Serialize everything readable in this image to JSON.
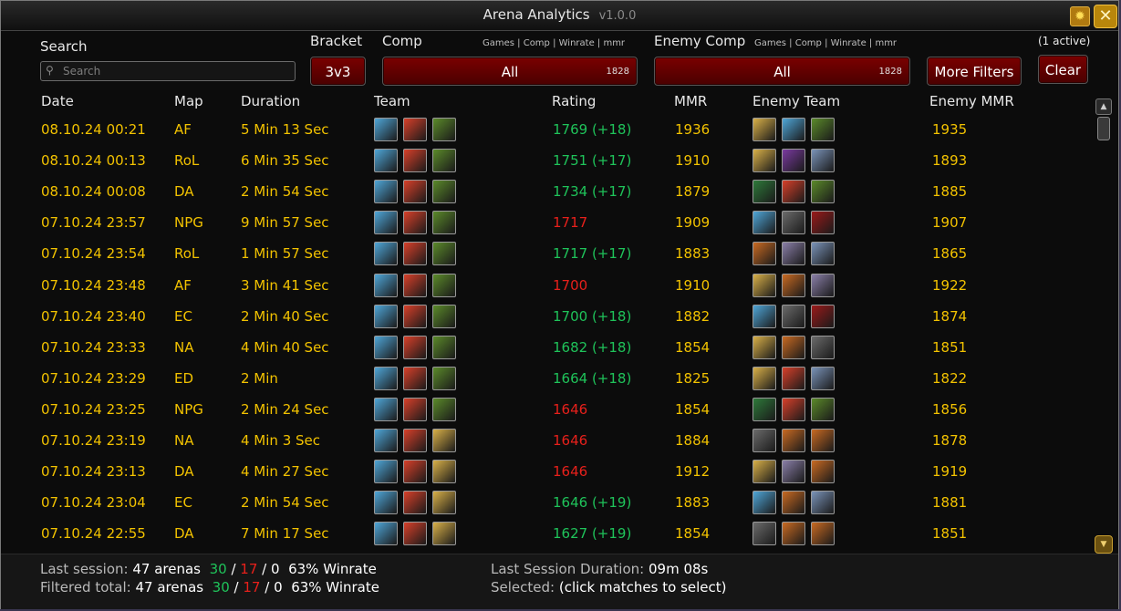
{
  "window": {
    "title": "Arena Analytics",
    "version": "v1.0.0"
  },
  "filters": {
    "search_label": "Search",
    "search_placeholder": "Search",
    "bracket_label": "Bracket",
    "bracket_value": "3v3",
    "comp_label": "Comp",
    "comp_subheader": "Games | Comp | Winrate | mmr",
    "comp_value": "All",
    "comp_count": "1828",
    "enemy_comp_label": "Enemy Comp",
    "enemy_comp_subheader": "Games | Comp | Winrate | mmr",
    "enemy_comp_value": "All",
    "enemy_comp_count": "1828",
    "more_filters_label": "More Filters",
    "active_label": "(1 active)",
    "clear_label": "Clear"
  },
  "columns": {
    "date": "Date",
    "map": "Map",
    "duration": "Duration",
    "team": "Team",
    "rating": "Rating",
    "mmr": "MMR",
    "enemy_team": "Enemy Team",
    "enemy_mmr": "Enemy MMR"
  },
  "icon_colors": {
    "frost-mage": "#4fa6d8",
    "fire-mage": "#d8402a",
    "rogue-poison": "#5b8a2a",
    "paladin-holy": "#d9b048",
    "priest-disc": "#8a7fa8",
    "warrior": "#7a93b8",
    "druid-feral": "#2e7a3a",
    "shaman-resto": "#c96a22",
    "warlock": "#7a3aa0",
    "hunter": "#6b6b6b",
    "dk-unholy": "#9a1a1a"
  },
  "matches": [
    {
      "date": "08.10.24  00:21",
      "map": "AF",
      "duration": "5 Min 13 Sec",
      "team": [
        "frost-mage",
        "fire-mage",
        "rogue-poison"
      ],
      "rating": "1769 (+18)",
      "win": true,
      "mmr": "1936",
      "enemy_team": [
        "paladin-holy",
        "frost-mage",
        "rogue-poison"
      ],
      "enemy_mmr": "1935"
    },
    {
      "date": "08.10.24  00:13",
      "map": "RoL",
      "duration": "6 Min 35 Sec",
      "team": [
        "frost-mage",
        "fire-mage",
        "rogue-poison"
      ],
      "rating": "1751 (+17)",
      "win": true,
      "mmr": "1910",
      "enemy_team": [
        "paladin-holy",
        "warlock",
        "warrior"
      ],
      "enemy_mmr": "1893"
    },
    {
      "date": "08.10.24  00:08",
      "map": "DA",
      "duration": "2 Min 54 Sec",
      "team": [
        "frost-mage",
        "fire-mage",
        "rogue-poison"
      ],
      "rating": "1734 (+17)",
      "win": true,
      "mmr": "1879",
      "enemy_team": [
        "druid-feral",
        "fire-mage",
        "rogue-poison"
      ],
      "enemy_mmr": "1885"
    },
    {
      "date": "07.10.24  23:57",
      "map": "NPG",
      "duration": "9 Min 57 Sec",
      "team": [
        "frost-mage",
        "fire-mage",
        "rogue-poison"
      ],
      "rating": "1717",
      "win": false,
      "mmr": "1909",
      "enemy_team": [
        "frost-mage",
        "hunter",
        "dk-unholy"
      ],
      "enemy_mmr": "1907"
    },
    {
      "date": "07.10.24  23:54",
      "map": "RoL",
      "duration": "1 Min 57 Sec",
      "team": [
        "frost-mage",
        "fire-mage",
        "rogue-poison"
      ],
      "rating": "1717 (+17)",
      "win": true,
      "mmr": "1883",
      "enemy_team": [
        "shaman-resto",
        "priest-disc",
        "warrior"
      ],
      "enemy_mmr": "1865"
    },
    {
      "date": "07.10.24  23:48",
      "map": "AF",
      "duration": "3 Min 41 Sec",
      "team": [
        "frost-mage",
        "fire-mage",
        "rogue-poison"
      ],
      "rating": "1700",
      "win": false,
      "mmr": "1910",
      "enemy_team": [
        "paladin-holy",
        "shaman-resto",
        "priest-disc"
      ],
      "enemy_mmr": "1922"
    },
    {
      "date": "07.10.24  23:40",
      "map": "EC",
      "duration": "2 Min 40 Sec",
      "team": [
        "frost-mage",
        "fire-mage",
        "rogue-poison"
      ],
      "rating": "1700 (+18)",
      "win": true,
      "mmr": "1882",
      "enemy_team": [
        "frost-mage",
        "hunter",
        "dk-unholy"
      ],
      "enemy_mmr": "1874"
    },
    {
      "date": "07.10.24  23:33",
      "map": "NA",
      "duration": "4 Min 40 Sec",
      "team": [
        "frost-mage",
        "fire-mage",
        "rogue-poison"
      ],
      "rating": "1682 (+18)",
      "win": true,
      "mmr": "1854",
      "enemy_team": [
        "paladin-holy",
        "shaman-resto",
        "hunter"
      ],
      "enemy_mmr": "1851"
    },
    {
      "date": "07.10.24  23:29",
      "map": "ED",
      "duration": "2 Min",
      "team": [
        "frost-mage",
        "fire-mage",
        "rogue-poison"
      ],
      "rating": "1664 (+18)",
      "win": true,
      "mmr": "1825",
      "enemy_team": [
        "paladin-holy",
        "fire-mage",
        "warrior"
      ],
      "enemy_mmr": "1822"
    },
    {
      "date": "07.10.24  23:25",
      "map": "NPG",
      "duration": "2 Min 24 Sec",
      "team": [
        "frost-mage",
        "fire-mage",
        "rogue-poison"
      ],
      "rating": "1646",
      "win": false,
      "mmr": "1854",
      "enemy_team": [
        "druid-feral",
        "fire-mage",
        "rogue-poison"
      ],
      "enemy_mmr": "1856"
    },
    {
      "date": "07.10.24  23:19",
      "map": "NA",
      "duration": "4 Min 3 Sec",
      "team": [
        "frost-mage",
        "fire-mage",
        "paladin-holy"
      ],
      "rating": "1646",
      "win": false,
      "mmr": "1884",
      "enemy_team": [
        "hunter",
        "shaman-resto",
        "shaman-resto"
      ],
      "enemy_mmr": "1878"
    },
    {
      "date": "07.10.24  23:13",
      "map": "DA",
      "duration": "4 Min 27 Sec",
      "team": [
        "frost-mage",
        "fire-mage",
        "paladin-holy"
      ],
      "rating": "1646",
      "win": false,
      "mmr": "1912",
      "enemy_team": [
        "paladin-holy",
        "priest-disc",
        "shaman-resto"
      ],
      "enemy_mmr": "1919"
    },
    {
      "date": "07.10.24  23:04",
      "map": "EC",
      "duration": "2 Min 54 Sec",
      "team": [
        "frost-mage",
        "fire-mage",
        "paladin-holy"
      ],
      "rating": "1646 (+19)",
      "win": true,
      "mmr": "1883",
      "enemy_team": [
        "frost-mage",
        "shaman-resto",
        "warrior"
      ],
      "enemy_mmr": "1881"
    },
    {
      "date": "07.10.24  22:55",
      "map": "DA",
      "duration": "7 Min 17 Sec",
      "team": [
        "frost-mage",
        "fire-mage",
        "paladin-holy"
      ],
      "rating": "1627 (+19)",
      "win": true,
      "mmr": "1854",
      "enemy_team": [
        "hunter",
        "shaman-resto",
        "shaman-resto"
      ],
      "enemy_mmr": "1851"
    }
  ],
  "footer": {
    "last_session_label": "Last session:",
    "last_session_arenas": "47 arenas",
    "last_session_wins": "30",
    "last_session_losses": "17",
    "last_session_draws": "0",
    "last_session_winrate": "63% Winrate",
    "filtered_label": "Filtered total:",
    "filtered_arenas": "47 arenas",
    "filtered_wins": "30",
    "filtered_losses": "17",
    "filtered_draws": "0",
    "filtered_winrate": "63% Winrate",
    "slash": "/",
    "duration_label": "Last Session Duration:",
    "duration_value": "09m 08s",
    "selected_label": "Selected:",
    "selected_value": "(click matches to select)"
  }
}
